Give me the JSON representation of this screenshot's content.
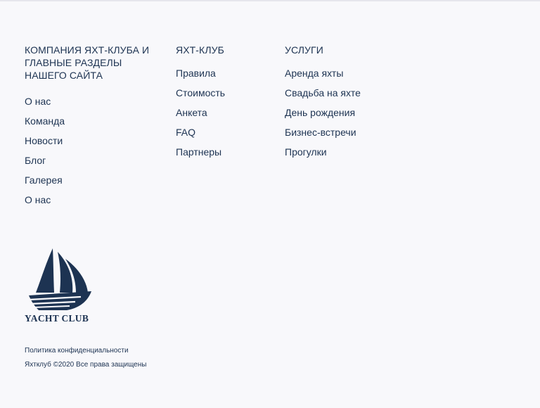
{
  "columns": {
    "company": {
      "title": "Компания яхт-клуба и главные разделы нашего сайта",
      "items": [
        "О нас",
        "Команда",
        "Новости",
        "Блог",
        "Галерея",
        "О нас"
      ]
    },
    "club": {
      "title": "Яхт-клуб",
      "items": [
        "Правила",
        "Стоимость",
        "Анкета",
        "FAQ",
        "Партнеры"
      ]
    },
    "services": {
      "title": "Услуги",
      "items": [
        "Аренда яхты",
        "Свадьба на яхте",
        "День рождения",
        "Бизнес-встречи",
        "Прогулки"
      ]
    }
  },
  "logo": {
    "text": "YACHT CLUB",
    "icon": "sailboat-icon"
  },
  "legal": {
    "privacy": "Политика конфиденциальности",
    "copyright": "Яхтклуб ©2020 Все права защищены"
  },
  "colors": {
    "background": "#f8f8fb",
    "text": "#1d3352",
    "divider": "#e6e6ec"
  }
}
